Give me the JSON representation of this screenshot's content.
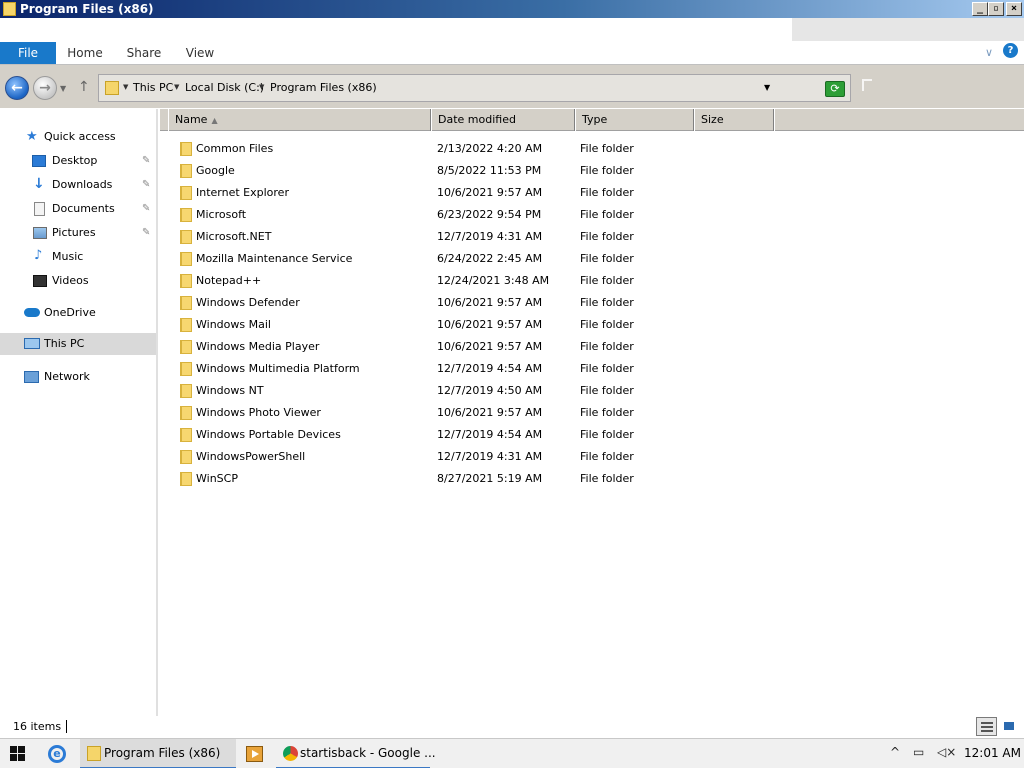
{
  "window": {
    "title": "Program Files (x86)"
  },
  "ribbon": {
    "tabs": [
      {
        "label": "File"
      },
      {
        "label": "Home"
      },
      {
        "label": "Share"
      },
      {
        "label": "View"
      }
    ],
    "accent_color": "#1979ca"
  },
  "address": {
    "crumbs": [
      "This PC",
      "Local Disk (C:)",
      "Program Files (x86)"
    ]
  },
  "sidebar": {
    "items": [
      {
        "label": "Quick access",
        "icon": "star-icon"
      },
      {
        "label": "Desktop",
        "icon": "desktop-icon",
        "pinned": true
      },
      {
        "label": "Downloads",
        "icon": "download-icon",
        "pinned": true
      },
      {
        "label": "Documents",
        "icon": "documents-icon",
        "pinned": true
      },
      {
        "label": "Pictures",
        "icon": "pictures-icon",
        "pinned": true
      },
      {
        "label": "Music",
        "icon": "music-icon"
      },
      {
        "label": "Videos",
        "icon": "videos-icon"
      },
      {
        "label": "OneDrive",
        "icon": "cloud-icon"
      },
      {
        "label": "This PC",
        "icon": "computer-icon",
        "selected": true
      },
      {
        "label": "Network",
        "icon": "network-icon"
      }
    ]
  },
  "columns": [
    {
      "label": "Name",
      "sorted": "ascending"
    },
    {
      "label": "Date modified"
    },
    {
      "label": "Type"
    },
    {
      "label": "Size"
    }
  ],
  "files": [
    {
      "name": "Common Files",
      "date": "2/13/2022 4:20 AM",
      "type": "File folder"
    },
    {
      "name": "Google",
      "date": "8/5/2022 11:53 PM",
      "type": "File folder"
    },
    {
      "name": "Internet Explorer",
      "date": "10/6/2021 9:57 AM",
      "type": "File folder"
    },
    {
      "name": "Microsoft",
      "date": "6/23/2022 9:54 PM",
      "type": "File folder"
    },
    {
      "name": "Microsoft.NET",
      "date": "12/7/2019 4:31 AM",
      "type": "File folder"
    },
    {
      "name": "Mozilla Maintenance Service",
      "date": "6/24/2022 2:45 AM",
      "type": "File folder"
    },
    {
      "name": "Notepad++",
      "date": "12/24/2021 3:48 AM",
      "type": "File folder"
    },
    {
      "name": "Windows Defender",
      "date": "10/6/2021 9:57 AM",
      "type": "File folder"
    },
    {
      "name": "Windows Mail",
      "date": "10/6/2021 9:57 AM",
      "type": "File folder"
    },
    {
      "name": "Windows Media Player",
      "date": "10/6/2021 9:57 AM",
      "type": "File folder"
    },
    {
      "name": "Windows Multimedia Platform",
      "date": "12/7/2019 4:54 AM",
      "type": "File folder"
    },
    {
      "name": "Windows NT",
      "date": "12/7/2019 4:50 AM",
      "type": "File folder"
    },
    {
      "name": "Windows Photo Viewer",
      "date": "10/6/2021 9:57 AM",
      "type": "File folder"
    },
    {
      "name": "Windows Portable Devices",
      "date": "12/7/2019 4:54 AM",
      "type": "File folder"
    },
    {
      "name": "WindowsPowerShell",
      "date": "12/7/2019 4:31 AM",
      "type": "File folder"
    },
    {
      "name": "WinSCP",
      "date": "8/27/2021 5:19 AM",
      "type": "File folder"
    }
  ],
  "status": {
    "item_count": "16 items"
  },
  "taskbar": {
    "tasks": [
      {
        "label": "Program Files (x86)",
        "icon": "folder-icon"
      },
      {
        "label": "startisback - Google ...",
        "icon": "chrome-icon"
      }
    ],
    "clock": "12:01 AM"
  }
}
